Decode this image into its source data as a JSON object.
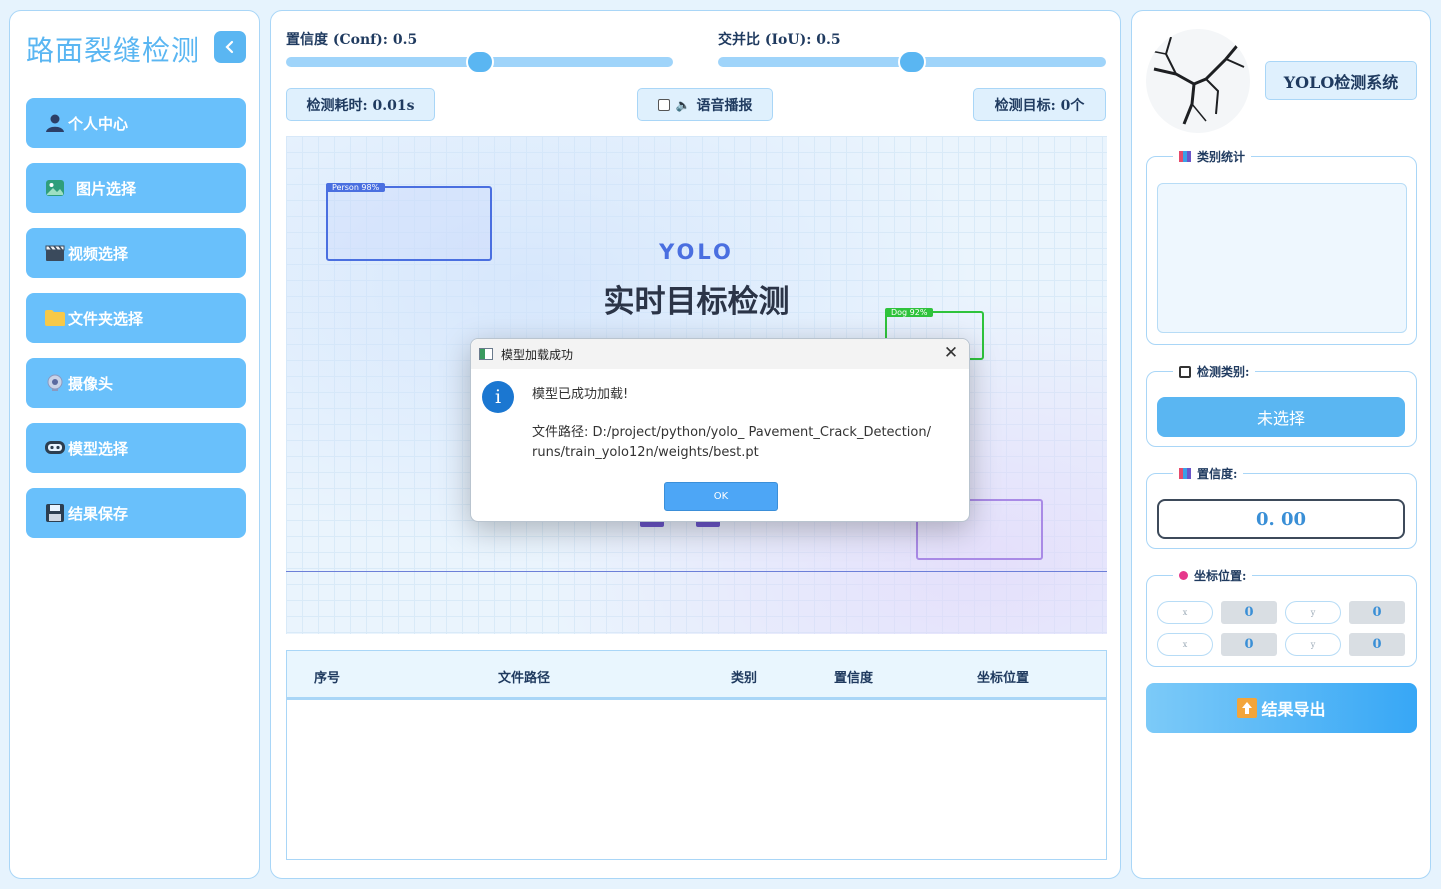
{
  "sidebar": {
    "title": "路面裂缝检测",
    "items": [
      {
        "label": "个人中心",
        "icon": "user-icon"
      },
      {
        "label": "图片选择",
        "icon": "image-icon"
      },
      {
        "label": "视频选择",
        "icon": "video-icon"
      },
      {
        "label": "文件夹选择",
        "icon": "folder-icon"
      },
      {
        "label": "摄像头",
        "icon": "camera-icon"
      },
      {
        "label": "模型选择",
        "icon": "model-icon"
      },
      {
        "label": "结果保存",
        "icon": "save-icon"
      }
    ]
  },
  "controls": {
    "conf_label": "置信度 (Conf): 0.5",
    "iou_label": "交并比 (IoU): 0.5",
    "conf_value": 0.5,
    "iou_value": 0.5,
    "time_label": "检测耗时: 0.01s",
    "voice_label": "语音播报",
    "targets_label": "检测目标: 0个"
  },
  "viewer": {
    "brand": "YOLO",
    "headline": "实时目标检测",
    "boxes": [
      {
        "label": "Person 98%",
        "color": "#4a6fe0"
      },
      {
        "label": "Dog 92%",
        "color": "#2fc33c"
      }
    ]
  },
  "table": {
    "columns": [
      "序号",
      "文件路径",
      "类别",
      "置信度",
      "坐标位置"
    ]
  },
  "right": {
    "system_title": "YOLO检测系统",
    "stats_title": "类别统计",
    "class_title": "检测类别:",
    "class_select": "未选择",
    "conf_title": "置信度:",
    "conf_display": "0. 00",
    "coord_title": "坐标位置:",
    "coords": [
      {
        "key": "x",
        "value": "0"
      },
      {
        "key": "y",
        "value": "0"
      },
      {
        "key": "x",
        "value": "0"
      },
      {
        "key": "y",
        "value": "0"
      }
    ],
    "export_label": "结果导出"
  },
  "dialog": {
    "title": "模型加载成功",
    "message": "模型已成功加载!",
    "path_line1": "文件路径: D:/project/python/yolo_ Pavement_Crack_Detection/",
    "path_line2": "runs/train_yolo12n/weights/best.pt",
    "ok_label": "OK"
  },
  "colors": {
    "accent": "#5ab6f2",
    "nav_button": "#69c0fb",
    "panel_border": "#a9d6f7"
  }
}
